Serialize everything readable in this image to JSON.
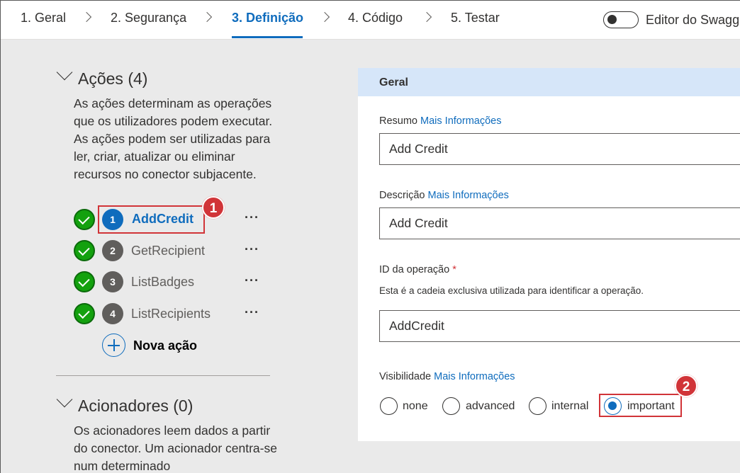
{
  "wizard": {
    "steps": [
      {
        "label": "1. Geral"
      },
      {
        "label": "2. Segurança"
      },
      {
        "label": "3. Definição"
      },
      {
        "label": "4. Código"
      },
      {
        "label": "5. Testar"
      }
    ],
    "active_step": 3,
    "swagger_toggle": {
      "label": "Editor do Swagger",
      "on": false
    }
  },
  "actions_section": {
    "title": "Ações (4)",
    "description": "As ações determinam as operações que os utilizadores podem executar. As ações podem ser utilizadas para ler, criar, atualizar ou eliminar recursos no conector subjacente.",
    "items": [
      {
        "number": "1",
        "name": "AddCredit",
        "more": "···",
        "active": true
      },
      {
        "number": "2",
        "name": "GetRecipient",
        "more": "···",
        "active": false
      },
      {
        "number": "3",
        "name": "ListBadges",
        "more": "···",
        "active": false
      },
      {
        "number": "4",
        "name": "ListRecipients",
        "more": "···",
        "active": false
      }
    ],
    "new_action_label": "Nova ação"
  },
  "triggers_section": {
    "title": "Acionadores (0)",
    "description": "Os acionadores leem dados a partir do conector. Um acionador centra-se num determinado"
  },
  "callouts": [
    "1",
    "2"
  ],
  "general_card": {
    "title": "Geral",
    "summary": {
      "label": "Resumo",
      "link": "Mais Informações",
      "value": "Add Credit"
    },
    "description": {
      "label": "Descrição",
      "link": "Mais Informações",
      "value": "Add Credit"
    },
    "operation_id": {
      "label": "ID da operação",
      "required_mark": "*",
      "help": "Esta é a cadeia exclusiva utilizada para identificar a operação.",
      "value": "AddCredit"
    },
    "visibility": {
      "label": "Visibilidade",
      "link": "Mais Informações",
      "options": [
        "none",
        "advanced",
        "internal",
        "important"
      ],
      "selected": "important"
    }
  },
  "colors": {
    "accent": "#0f6cbd",
    "success": "#13a10e",
    "callout": "#d13438",
    "card_header": "#d6e6f9",
    "panel_bg": "#eaeaea"
  }
}
